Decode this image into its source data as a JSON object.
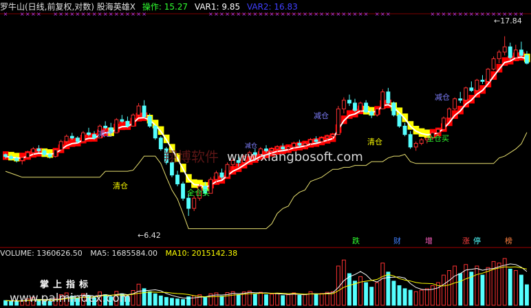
{
  "header": {
    "title": "罗牛山(日线,前复权,对数) 股海英雄X",
    "op_label": "操作: 15.27",
    "var1_label": "VAR1: 9.85",
    "var2_label": "VAR2: 16.83"
  },
  "volume_header": {
    "volume_label": "VOLUME: 1360626.50",
    "ma5_label": "MA5: 1685584.00",
    "ma10_label": "MA10: 2015142.38"
  },
  "annotations": {
    "reduce1": "减仓",
    "reduce2": "减仓",
    "reduce3": "减仓",
    "reduce4": "减仓",
    "clear1": "清仓",
    "clear2": "清仓",
    "buy1": "全仓买",
    "buy2": "全仓买",
    "low_price": "6.42",
    "high_price": "17.84"
  },
  "legend_tags": [
    "跌",
    "财",
    "增",
    "涨",
    "停",
    "榜"
  ],
  "watermarks": {
    "cn": "翔博软件",
    "url": "www.xiangbosoft.com",
    "bottom_cn": "掌上指标",
    "bottom_url": "www.palmindex.com"
  },
  "colors": {
    "up": "#ff3232",
    "down": "#54ffff",
    "white_line": "#ffffff",
    "yellow_line": "#e8e070",
    "purple": "#c040ff",
    "yellow_band": "#ffff00",
    "red_band": "#ff0000"
  },
  "chart_data": {
    "type": "candlestick",
    "price_range": [
      5.8,
      19.5
    ],
    "log_scale": true,
    "candles": [
      [
        9.1,
        9.15,
        8.9,
        9.0
      ],
      [
        9.0,
        9.1,
        8.8,
        8.9
      ],
      [
        8.9,
        9.0,
        8.7,
        8.8
      ],
      [
        8.8,
        9.0,
        8.6,
        8.95
      ],
      [
        8.95,
        9.3,
        8.9,
        9.2
      ],
      [
        9.2,
        9.5,
        9.1,
        9.4
      ],
      [
        9.4,
        9.6,
        9.2,
        9.3
      ],
      [
        9.3,
        9.4,
        9.0,
        9.1
      ],
      [
        9.1,
        9.2,
        8.9,
        9.0
      ],
      [
        9.0,
        9.4,
        8.95,
        9.35
      ],
      [
        9.35,
        9.9,
        9.3,
        9.8
      ],
      [
        9.8,
        10.2,
        9.7,
        10.1
      ],
      [
        10.1,
        10.3,
        9.9,
        10.0
      ],
      [
        10.0,
        10.1,
        9.7,
        9.8
      ],
      [
        9.8,
        10.4,
        9.8,
        10.3
      ],
      [
        10.3,
        10.6,
        10.1,
        10.2
      ],
      [
        10.2,
        10.4,
        9.9,
        10.0
      ],
      [
        10.0,
        10.8,
        10.0,
        10.7
      ],
      [
        10.7,
        11.0,
        10.5,
        10.6
      ],
      [
        10.6,
        10.9,
        10.2,
        10.3
      ],
      [
        10.3,
        11.2,
        10.3,
        11.1
      ],
      [
        11.1,
        11.4,
        10.9,
        11.0
      ],
      [
        11.0,
        11.3,
        10.6,
        10.7
      ],
      [
        10.7,
        11.5,
        10.7,
        11.4
      ],
      [
        11.4,
        12.2,
        11.3,
        12.0
      ],
      [
        12.0,
        12.4,
        11.2,
        11.3
      ],
      [
        11.3,
        11.5,
        10.6,
        10.7
      ],
      [
        10.7,
        10.8,
        9.9,
        10.0
      ],
      [
        10.0,
        10.1,
        9.3,
        9.4
      ],
      [
        9.4,
        9.5,
        8.6,
        8.7
      ],
      [
        8.7,
        8.8,
        8.0,
        8.1
      ],
      [
        8.1,
        8.3,
        7.6,
        7.7
      ],
      [
        7.7,
        7.8,
        7.0,
        7.1
      ],
      [
        7.1,
        7.3,
        6.42,
        6.7
      ],
      [
        6.7,
        7.2,
        6.6,
        7.1
      ],
      [
        7.1,
        7.7,
        7.0,
        7.6
      ],
      [
        7.6,
        7.8,
        7.2,
        7.3
      ],
      [
        7.3,
        8.0,
        7.3,
        7.9
      ],
      [
        7.9,
        8.3,
        7.7,
        8.2
      ],
      [
        8.2,
        8.4,
        7.9,
        8.0
      ],
      [
        8.0,
        8.7,
        8.0,
        8.6
      ],
      [
        8.6,
        8.9,
        8.4,
        8.8
      ],
      [
        8.8,
        9.0,
        8.5,
        8.7
      ],
      [
        8.7,
        9.1,
        8.6,
        9.0
      ],
      [
        9.0,
        9.3,
        8.8,
        9.2
      ],
      [
        9.2,
        9.4,
        9.0,
        9.1
      ],
      [
        9.1,
        9.5,
        9.0,
        9.4
      ],
      [
        9.4,
        9.6,
        9.2,
        9.3
      ],
      [
        9.3,
        9.5,
        9.1,
        9.4
      ],
      [
        9.4,
        9.6,
        9.2,
        9.5
      ],
      [
        9.5,
        9.7,
        9.3,
        9.4
      ],
      [
        9.4,
        9.6,
        9.2,
        9.5
      ],
      [
        9.5,
        9.8,
        9.4,
        9.7
      ],
      [
        9.7,
        9.9,
        9.5,
        9.6
      ],
      [
        9.6,
        9.8,
        9.4,
        9.7
      ],
      [
        9.7,
        10.0,
        9.6,
        9.9
      ],
      [
        9.9,
        10.1,
        9.7,
        9.8
      ],
      [
        9.8,
        10.1,
        9.7,
        10.0
      ],
      [
        10.0,
        10.2,
        9.8,
        10.1
      ],
      [
        10.1,
        10.3,
        9.9,
        10.2
      ],
      [
        10.2,
        12.0,
        10.2,
        11.8
      ],
      [
        11.8,
        12.6,
        11.5,
        12.4
      ],
      [
        12.4,
        12.8,
        12.0,
        12.2
      ],
      [
        12.2,
        12.5,
        11.6,
        11.7
      ],
      [
        11.7,
        12.3,
        11.6,
        12.2
      ],
      [
        12.2,
        12.4,
        11.5,
        11.6
      ],
      [
        11.6,
        11.8,
        11.2,
        11.4
      ],
      [
        11.4,
        11.9,
        11.3,
        11.8
      ],
      [
        11.8,
        13.2,
        11.8,
        13.0
      ],
      [
        13.0,
        13.3,
        12.1,
        12.2
      ],
      [
        12.2,
        12.3,
        11.3,
        11.4
      ],
      [
        11.4,
        11.5,
        10.6,
        10.7
      ],
      [
        10.7,
        10.9,
        10.1,
        10.2
      ],
      [
        10.2,
        10.4,
        9.4,
        9.5
      ],
      [
        9.5,
        9.8,
        9.3,
        9.7
      ],
      [
        9.7,
        10.0,
        9.6,
        9.9
      ],
      [
        9.9,
        10.1,
        9.7,
        10.0
      ],
      [
        10.0,
        10.4,
        9.9,
        10.3
      ],
      [
        10.3,
        10.6,
        10.1,
        10.5
      ],
      [
        10.5,
        11.3,
        10.4,
        11.2
      ],
      [
        11.2,
        11.9,
        11.1,
        11.8
      ],
      [
        11.8,
        12.6,
        11.7,
        12.5
      ],
      [
        12.5,
        13.0,
        12.2,
        12.4
      ],
      [
        12.4,
        13.4,
        12.3,
        13.3
      ],
      [
        13.3,
        13.8,
        13.0,
        13.1
      ],
      [
        13.1,
        14.0,
        13.0,
        13.9
      ],
      [
        13.9,
        14.3,
        13.6,
        13.8
      ],
      [
        13.8,
        14.9,
        13.7,
        14.8
      ],
      [
        14.8,
        15.9,
        14.7,
        15.7
      ],
      [
        15.7,
        16.5,
        15.3,
        16.3
      ],
      [
        16.3,
        17.84,
        16.0,
        16.8
      ],
      [
        16.8,
        17.2,
        15.6,
        15.8
      ],
      [
        15.8,
        17.0,
        15.5,
        16.5
      ],
      [
        16.5,
        17.3,
        15.9,
        16.0
      ],
      [
        16.0,
        16.4,
        15.2,
        15.3
      ]
    ],
    "volume": [
      310,
      280,
      260,
      300,
      420,
      520,
      380,
      300,
      260,
      450,
      700,
      820,
      600,
      480,
      760,
      640,
      500,
      880,
      700,
      560,
      920,
      760,
      580,
      980,
      1400,
      1100,
      900,
      760,
      620,
      520,
      460,
      420,
      380,
      560,
      620,
      700,
      520,
      760,
      820,
      600,
      840,
      900,
      700,
      880,
      940,
      720,
      860,
      700,
      740,
      800,
      640,
      700,
      820,
      660,
      700,
      900,
      720,
      780,
      860,
      900,
      2600,
      3000,
      2100,
      1600,
      1900,
      1500,
      1200,
      1500,
      2800,
      2200,
      1600,
      1300,
      1100,
      1000,
      900,
      1000,
      1100,
      1300,
      1500,
      2000,
      2300,
      2600,
      2100,
      2700,
      2200,
      2600,
      2000,
      2500,
      2900,
      2800,
      3100,
      2400,
      2300,
      2000,
      1360
    ],
    "ma5_latest": 1685584.0,
    "ma10_latest": 2015142.38,
    "volume_latest": 1360626.5
  }
}
